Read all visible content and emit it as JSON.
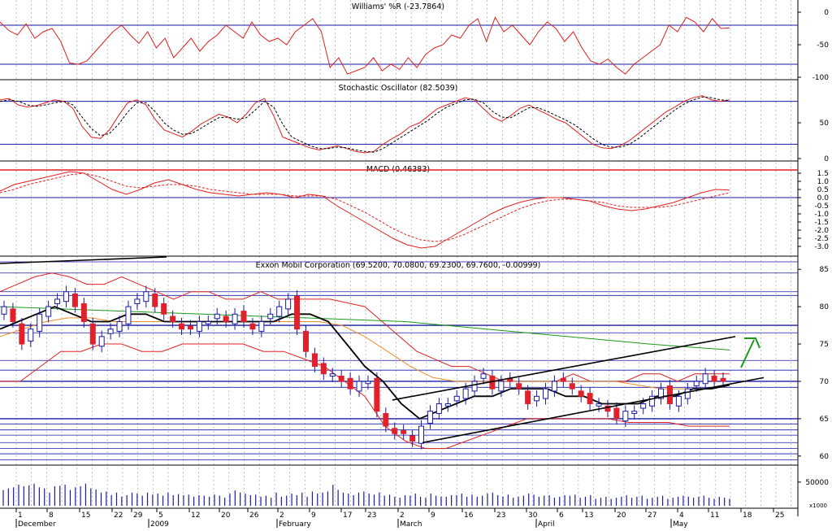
{
  "colors": {
    "red": "#e02020",
    "blue": "#1a1aa6",
    "black": "#000000",
    "orange": "#f08c28",
    "green": "#1a9a1a",
    "grid": "#9a9a9a",
    "bg": "#ffffff",
    "up": "#ffffff",
    "down": "#e0202a"
  },
  "chart_data": [
    {
      "type": "line",
      "title": "Williams' %R (-23.7864)",
      "ylim": [
        -100,
        0
      ],
      "ticks": [
        "0",
        "-50",
        "-100"
      ],
      "tick_values": [
        0,
        -50,
        -100
      ],
      "hlines": [
        -20,
        -80
      ],
      "series": [
        {
          "color": "red",
          "values": [
            -15,
            -28,
            -35,
            -18,
            -40,
            -30,
            -25,
            -45,
            -78,
            -80,
            -75,
            -60,
            -45,
            -30,
            -20,
            -35,
            -48,
            -30,
            -55,
            -40,
            -70,
            -55,
            -40,
            -60,
            -45,
            -35,
            -20,
            -30,
            -40,
            -15,
            -35,
            -45,
            -40,
            -50,
            -30,
            -20,
            -10,
            -30,
            -85,
            -70,
            -95,
            -90,
            -85,
            -70,
            -90,
            -80,
            -88,
            -70,
            -85,
            -65,
            -55,
            -50,
            -35,
            -40,
            -20,
            -10,
            -45,
            -8,
            -30,
            -20,
            -35,
            -50,
            -30,
            -15,
            -25,
            -45,
            -30,
            -55,
            -75,
            -80,
            -72,
            -85,
            -95,
            -80,
            -70,
            -60,
            -50,
            -20,
            -30,
            -8,
            -15,
            -30,
            -10,
            -25,
            -24
          ]
        }
      ]
    },
    {
      "type": "line",
      "title": "Stochastic Oscillator (82.5039)",
      "ylim": [
        0,
        100
      ],
      "ticks": [
        "50",
        "0"
      ],
      "tick_values": [
        50,
        0
      ],
      "hlines": [
        20,
        80
      ],
      "series": [
        {
          "name": "%K",
          "color": "red",
          "dashed": false,
          "values": [
            82,
            84,
            75,
            72,
            74,
            78,
            82,
            80,
            70,
            45,
            30,
            28,
            40,
            60,
            78,
            82,
            75,
            55,
            40,
            35,
            30,
            38,
            48,
            55,
            62,
            58,
            50,
            62,
            78,
            84,
            60,
            30,
            25,
            20,
            15,
            12,
            15,
            18,
            14,
            10,
            8,
            10,
            20,
            28,
            35,
            45,
            50,
            60,
            70,
            75,
            80,
            85,
            82,
            70,
            58,
            52,
            60,
            70,
            75,
            68,
            62,
            55,
            50,
            40,
            30,
            20,
            15,
            14,
            18,
            25,
            35,
            45,
            55,
            65,
            72,
            80,
            85,
            88,
            82,
            80,
            82
          ]
        },
        {
          "name": "%D",
          "color": "black",
          "dashed": true,
          "values": [
            80,
            82,
            80,
            75,
            73,
            75,
            78,
            80,
            75,
            58,
            42,
            32,
            35,
            48,
            65,
            78,
            78,
            66,
            50,
            40,
            34,
            35,
            42,
            50,
            57,
            58,
            55,
            57,
            68,
            80,
            72,
            48,
            30,
            24,
            18,
            14,
            14,
            16,
            15,
            12,
            10,
            9,
            14,
            22,
            30,
            38,
            46,
            54,
            64,
            72,
            77,
            82,
            83,
            78,
            66,
            58,
            57,
            64,
            71,
            71,
            66,
            60,
            54,
            47,
            38,
            28,
            20,
            16,
            16,
            20,
            28,
            38,
            48,
            58,
            68,
            76,
            82,
            86,
            85,
            82,
            81
          ]
        }
      ]
    },
    {
      "type": "line",
      "title": "MACD (0.46383)",
      "ylim": [
        -3.5,
        2.0
      ],
      "ticks": [
        "1.5",
        "1.0",
        "0.5",
        "0.0",
        "-0.5",
        "-1.0",
        "-1.5",
        "-2.0",
        "-2.5",
        "-3.0"
      ],
      "tick_values": [
        1.5,
        1.0,
        0.5,
        0.0,
        -0.5,
        -1.0,
        -1.5,
        -2.0,
        -2.5,
        -3.0
      ],
      "hlines": [
        1.7,
        0.0
      ],
      "series": [
        {
          "name": "MACD",
          "color": "red",
          "dashed": false,
          "values": [
            0.4,
            0.8,
            1.0,
            1.2,
            1.4,
            1.6,
            1.5,
            1.0,
            0.5,
            0.2,
            0.5,
            0.9,
            1.1,
            0.8,
            0.5,
            0.3,
            0.2,
            0.1,
            0.2,
            0.3,
            0.2,
            0.0,
            0.2,
            0.1,
            -0.5,
            -1.0,
            -1.5,
            -2.0,
            -2.5,
            -2.9,
            -3.1,
            -3.0,
            -2.5,
            -2.0,
            -1.5,
            -1.0,
            -0.6,
            -0.3,
            -0.1,
            0.0,
            0.0,
            -0.1,
            -0.2,
            -0.5,
            -0.7,
            -0.8,
            -0.7,
            -0.5,
            -0.3,
            0.0,
            0.3,
            0.5,
            0.46
          ]
        },
        {
          "name": "Signal",
          "color": "red",
          "dashed": true,
          "values": [
            0.3,
            0.5,
            0.8,
            1.0,
            1.2,
            1.4,
            1.5,
            1.3,
            1.0,
            0.7,
            0.6,
            0.7,
            0.8,
            0.8,
            0.7,
            0.5,
            0.4,
            0.3,
            0.2,
            0.2,
            0.2,
            0.1,
            0.1,
            0.1,
            -0.1,
            -0.5,
            -0.9,
            -1.4,
            -1.9,
            -2.3,
            -2.6,
            -2.7,
            -2.6,
            -2.3,
            -1.9,
            -1.5,
            -1.1,
            -0.7,
            -0.4,
            -0.2,
            -0.1,
            -0.1,
            -0.2,
            -0.3,
            -0.5,
            -0.6,
            -0.6,
            -0.6,
            -0.5,
            -0.3,
            -0.1,
            0.1,
            0.3
          ]
        }
      ]
    },
    {
      "type": "candlestick",
      "title": "Exxon Mobil Corporation (69.5200, 70.0800, 69.2300, 69.7600, -0.00999)",
      "ylim": [
        59,
        86
      ],
      "ticks": [
        "85",
        "80",
        "75",
        "70",
        "65",
        "60"
      ],
      "tick_values": [
        85,
        80,
        75,
        70,
        65,
        60
      ],
      "closes": [
        80,
        78,
        75,
        77,
        79,
        80,
        81,
        82,
        80,
        78,
        75,
        76,
        77,
        78,
        80,
        81,
        82,
        80,
        79,
        78,
        77,
        77,
        78,
        78,
        79,
        78,
        79,
        78,
        77,
        78,
        79,
        80,
        81,
        77,
        74,
        72,
        71,
        71,
        70,
        69,
        70,
        70,
        66,
        64,
        63,
        63,
        62,
        64,
        66,
        67,
        67,
        68,
        69,
        70,
        71,
        69,
        70,
        70,
        69,
        67,
        68,
        69,
        70,
        70,
        69,
        68,
        67,
        67,
        66,
        65,
        66,
        66,
        67,
        68,
        69,
        67,
        68,
        69,
        70,
        71,
        70,
        70
      ],
      "overlays": [
        {
          "name": "bollinger-upper",
          "color": "red",
          "values": [
            82,
            83,
            84,
            84.5,
            84,
            83,
            83,
            84,
            83,
            82,
            81,
            82,
            82,
            81,
            81,
            82,
            81,
            81,
            81,
            81,
            80.5,
            80,
            78,
            76,
            74,
            73,
            72,
            72,
            71,
            70,
            70,
            70,
            70,
            71,
            70,
            70,
            70,
            71,
            71,
            70,
            71,
            71,
            71
          ]
        },
        {
          "name": "bollinger-lower",
          "color": "red",
          "values": [
            70,
            70,
            72,
            74,
            74,
            75,
            75,
            74,
            74,
            75,
            75,
            75,
            75,
            74,
            74,
            73,
            72,
            70,
            68,
            64,
            62,
            61,
            61,
            62,
            63,
            64,
            65,
            65,
            65,
            65,
            65,
            64.5,
            64.5,
            64.5,
            64,
            64,
            64
          ]
        },
        {
          "name": "moving-average-short",
          "color": "black",
          "values": [
            77,
            78,
            79,
            80,
            79,
            78,
            78,
            79,
            79,
            78,
            78,
            78,
            78,
            78,
            78,
            78,
            79,
            79,
            78,
            75,
            72,
            70,
            67,
            65,
            66,
            67,
            68,
            68,
            69,
            69,
            69,
            68,
            68,
            67,
            67,
            67,
            68,
            68,
            69,
            69,
            69.5
          ]
        },
        {
          "name": "moving-average-mid",
          "color": "orange",
          "values": [
            76,
            77,
            78,
            78.5,
            78.5,
            78,
            78,
            78,
            78,
            78,
            78,
            78,
            78,
            78,
            78,
            77.5,
            76,
            74,
            72,
            70.5,
            70,
            70,
            70,
            70,
            70,
            70,
            70,
            70,
            69.5,
            69,
            69,
            69,
            69.5
          ]
        },
        {
          "name": "moving-average-long",
          "color": "green",
          "values": [
            80,
            79.8,
            79.6,
            79.4,
            79.2,
            79,
            78.8,
            78.6,
            78.4,
            78.2,
            78,
            77.5,
            77,
            76.5,
            76,
            75.5,
            75,
            74.6,
            74.2
          ]
        }
      ]
    },
    {
      "type": "bar",
      "title": "",
      "ylim": [
        0,
        70000
      ],
      "ticks": [
        "50000"
      ],
      "tick_values": [
        50000
      ],
      "unit_label": "x1000",
      "values": [
        35,
        38,
        40,
        45,
        42,
        44,
        47,
        40,
        38,
        30,
        42,
        43,
        45,
        35,
        40,
        42,
        47,
        38,
        36,
        30,
        32,
        25,
        30,
        22,
        25,
        30,
        28,
        24,
        30,
        26,
        28,
        24,
        30,
        25,
        27,
        25,
        26,
        22,
        25,
        24,
        22,
        26,
        24,
        20,
        28,
        34,
        30,
        28,
        25,
        26,
        22,
        24,
        20,
        30,
        22,
        24,
        28,
        25,
        30,
        22,
        32,
        28,
        30,
        32,
        45,
        35,
        30,
        28,
        25,
        30,
        32,
        28,
        26,
        30,
        24,
        26,
        22,
        20,
        25,
        24,
        28,
        22,
        20,
        28,
        24,
        22,
        22,
        25,
        25,
        28,
        22,
        26,
        22,
        24,
        28,
        30,
        25,
        22,
        26,
        20,
        22,
        24,
        28,
        26,
        22,
        24,
        25,
        20,
        22,
        25,
        24,
        26,
        20,
        22,
        25,
        18,
        20,
        22,
        18,
        20,
        22,
        25,
        20,
        22,
        24,
        18,
        20,
        22,
        24,
        18,
        20,
        22,
        24,
        22,
        20,
        22,
        24,
        20,
        18,
        22,
        20,
        18
      ]
    }
  ],
  "x_axis": {
    "day_ticks": [
      "1",
      "8",
      "15",
      "22",
      "29",
      "5",
      "12",
      "20",
      "26",
      "2",
      "9",
      "17",
      "23",
      "2",
      "9",
      "16",
      "23",
      "30",
      "6",
      "13",
      "20",
      "27",
      "4",
      "11",
      "18",
      "25"
    ],
    "months": [
      "December",
      "2009",
      "February",
      "March",
      "April",
      "May"
    ]
  }
}
